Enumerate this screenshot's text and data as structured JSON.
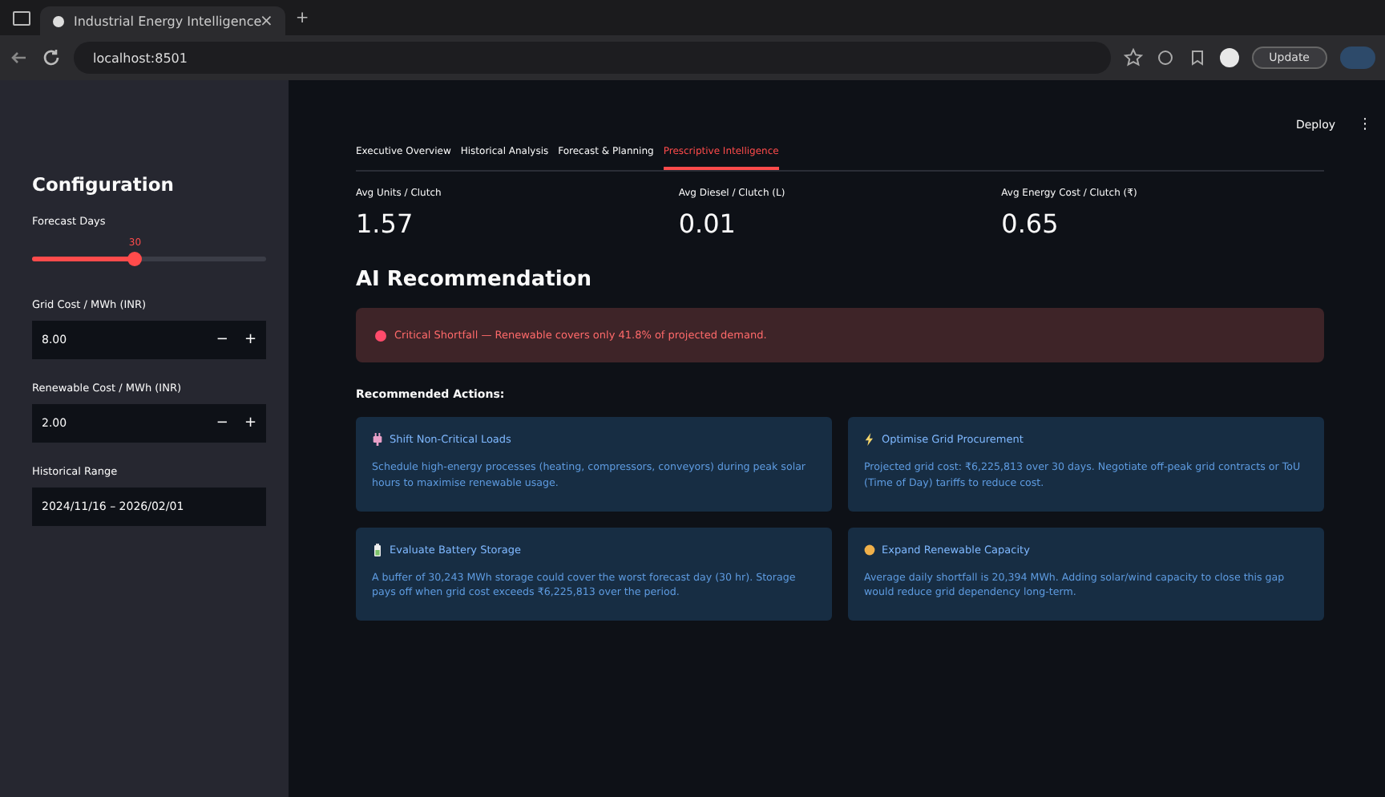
{
  "browser": {
    "tab_title": "Industrial Energy Intelligence",
    "tab_close": "×",
    "new_tab": "+",
    "url": "localhost:8501",
    "update_button": "Update"
  },
  "header": {
    "deploy": "Deploy",
    "menu": "⋮"
  },
  "sidebar": {
    "title": "Configuration",
    "slider": {
      "label": "Forecast Days",
      "value": "30",
      "level": 0.44
    },
    "inputs": [
      {
        "label": "Grid Cost / MWh (INR)",
        "value": "8.00",
        "minus": "−",
        "plus": "+"
      },
      {
        "label": "Renewable Cost / MWh (INR)",
        "value": "2.00",
        "minus": "−",
        "plus": "+"
      }
    ],
    "date_range": {
      "label": "Historical Range",
      "value": "2024/11/16 – 2026/02/01"
    }
  },
  "tabs": [
    {
      "label": "Executive Overview",
      "selected": false
    },
    {
      "label": "Historical Analysis",
      "selected": false
    },
    {
      "label": "Forecast & Planning",
      "selected": false
    },
    {
      "label": "Prescriptive Intelligence",
      "selected": true
    }
  ],
  "metrics": [
    {
      "label": "Avg Units / Clutch",
      "value": "1.57"
    },
    {
      "label": "Avg Diesel / Clutch (L)",
      "value": "0.01"
    },
    {
      "label": "Avg Energy Cost / Clutch (₹)",
      "value": "0.65"
    }
  ],
  "section_title": "AI Recommendation",
  "alert": {
    "kind": "error",
    "text": "Critical Shortfall — Renewable covers only 41.8% of projected demand."
  },
  "actions_title": "Recommended Actions:",
  "cards": [
    {
      "kind": "plug",
      "title": "Shift Non-Critical Loads",
      "body": "Schedule high-energy processes (heating, compressors, conveyors) during peak solar hours to maximise renewable usage."
    },
    {
      "kind": "bolt",
      "title": "Optimise Grid Procurement",
      "body": "Projected grid cost: ₹6,225,813 over 30 days. Negotiate off-peak grid contracts or ToU (Time of Day) tariffs to reduce cost."
    },
    {
      "kind": "battery",
      "title": "Evaluate Battery Storage",
      "body": "A buffer of 30,243 MWh storage could cover the worst forecast day (30 hr). Storage pays off when grid cost exceeds ₹6,225,813 over the period."
    },
    {
      "kind": "sun",
      "title": "Expand Renewable Capacity",
      "body": "Average daily shortfall is 20,394 MWh. Adding solar/wind capacity to close this gap would reduce grid dependency long-term."
    }
  ]
}
